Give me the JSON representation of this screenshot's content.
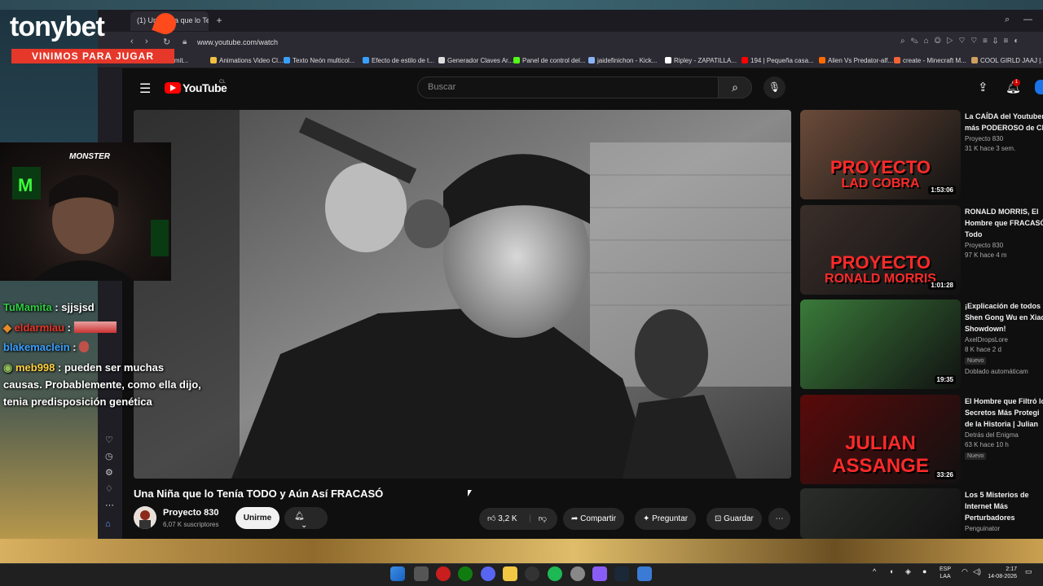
{
  "overlay": {
    "brand": "tonybet",
    "tagline": "VINIMOS PARA JUGAR",
    "webcam_logo": "MONSTER",
    "chat": [
      {
        "user": "TuMamita",
        "message": "sjjsjsd",
        "color": "#2ecc40"
      },
      {
        "user": "eldarmiau",
        "message": "",
        "color": "#e5372a"
      },
      {
        "user": "blakemaclein",
        "message": "",
        "color": "#3aa0ff"
      },
      {
        "user": "meb998",
        "message": "pueden ser muchas",
        "color": "#ffd23f"
      },
      {
        "user": "",
        "message": "causas. Probablemente, como ella dijo,",
        "color": "#ffffff"
      },
      {
        "user": "",
        "message": "tenia predisposición genética",
        "color": "#ffffff"
      }
    ]
  },
  "browser": {
    "tab_title": "(1) Una Niña que lo Te",
    "url": "www.youtube.com/watch",
    "bookmarks": [
      {
        "label": "/ semit...",
        "icon": "bookmark-icon",
        "color": "#888888"
      },
      {
        "label": "Animations Video Cl...",
        "icon": "grid-icon",
        "color": "#f0c040"
      },
      {
        "label": "Texto Neón multicol...",
        "icon": "t-icon",
        "color": "#3aa0ff"
      },
      {
        "label": "Efecto de estilo de t...",
        "icon": "t-icon",
        "color": "#3aa0ff"
      },
      {
        "label": "Generador Claves Ar...",
        "icon": "doc-icon",
        "color": "#dddddd"
      },
      {
        "label": "Panel de control del...",
        "icon": "k-icon",
        "color": "#53fc18"
      },
      {
        "label": "jaidefinichon - Kick...",
        "icon": "globe-icon",
        "color": "#8ab4f8"
      },
      {
        "label": "Ripley - ZAPATILLA...",
        "icon": "r-icon",
        "color": "#ffffff"
      },
      {
        "label": "194 | Pequeña casa...",
        "icon": "youtube-icon",
        "color": "#ff0000"
      },
      {
        "label": "Alien Vs Predator-alf...",
        "icon": "shield-icon",
        "color": "#ff6a00"
      },
      {
        "label": "create - Minecraft M...",
        "icon": "curseforge-icon",
        "color": "#f16436"
      },
      {
        "label": "COOL GIRLD JAAJ |...",
        "icon": "bookmark-icon",
        "color": "#d0a060"
      }
    ]
  },
  "youtube": {
    "logo_text": "YouTube",
    "region": "CL",
    "search_placeholder": "Buscar",
    "notification_count": "1",
    "video": {
      "title": "Una Niña que lo Tenía TODO y Aún Así FRACASÓ",
      "channel": "Proyecto 830",
      "subscribers": "6,07 K suscriptores",
      "join_label": "Unirme",
      "likes": "3,2 K",
      "share_label": "Compartir",
      "ask_label": "Preguntar",
      "save_label": "Guardar"
    },
    "recommendations": [
      {
        "title1": "La CAÍDA del Youtuber",
        "title2": "más PODEROSO de Ch",
        "title3": "",
        "channel": "Proyecto 830",
        "meta": "31 K  hace 3 sem.",
        "badge": "",
        "duration": "1:53:06",
        "thumb_text1": "PROYECTO",
        "thumb_text2": "LAD COBRA",
        "thumb_bg": "#6b4b3a"
      },
      {
        "title1": "RONALD MORRIS, El",
        "title2": "Hombre que FRACASÓ",
        "title3": "Todo",
        "channel": "Proyecto 830",
        "meta": "97 K  hace 4 m",
        "badge": "",
        "duration": "1:01:28",
        "thumb_text1": "PROYECTO",
        "thumb_text2": "RONALD MORRIS",
        "thumb_bg": "#3a2e2a"
      },
      {
        "title1": "¡Explicación de todos l",
        "title2": "Shen Gong Wu en Xiao",
        "title3": "Showdown!",
        "channel": "AxelDropsLore",
        "meta": "8 K  hace 2 d",
        "badge": "Nuevo",
        "extra": "Doblado automáticam",
        "duration": "19:35",
        "thumb_text1": "",
        "thumb_text2": "",
        "thumb_bg": "#3a7a3a"
      },
      {
        "title1": "El Hombre que Filtró lo",
        "title2": "Secretos Más Protegi",
        "title3": "de la Historia | Julian",
        "channel": "Detrás del Enigma",
        "meta": "63 K  hace 10 h",
        "badge": "Nuevo",
        "duration": "33:26",
        "thumb_text1": "JULIAN ASSANGE",
        "thumb_text2": "",
        "thumb_bg": "#5a0a0a"
      },
      {
        "title1": "Los 5 Misterios de",
        "title2": "Internet Más",
        "title3": "Perturbadores",
        "channel": "Penguinator",
        "meta": "",
        "badge": "",
        "duration": "",
        "thumb_text1": "",
        "thumb_text2": "",
        "thumb_bg": "#2a2e2a"
      }
    ]
  },
  "taskbar": {
    "language": "ESP",
    "layout": "LAA",
    "time": "2:17",
    "date": "14-08-2026"
  },
  "colors": {
    "yt_red": "#ff0000",
    "overlay_red": "#e5372a",
    "thumb_red_text": "#ff2a2a"
  }
}
